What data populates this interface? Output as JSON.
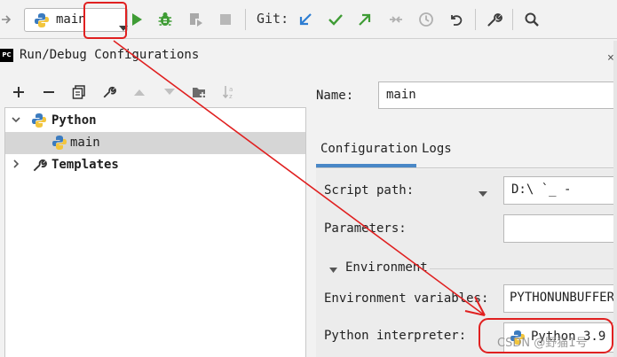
{
  "toolbar": {
    "run_config_label": "main",
    "git_label": "Git:",
    "icons": [
      "arrow-right-icon",
      "python-icon",
      "chevron-down-icon",
      "run-icon",
      "debug-icon",
      "coverage-icon",
      "stop-icon",
      "git-update-icon",
      "git-commit-icon",
      "git-push-icon",
      "git-compare-icon",
      "git-history-icon",
      "git-rollback-icon",
      "settings-icon",
      "search-icon"
    ]
  },
  "dialog": {
    "title": "Run/Debug Configurations",
    "logo_text": "PC"
  },
  "tree_tools": [
    "add-icon",
    "remove-icon",
    "copy-icon",
    "edit-wrench-icon",
    "move-up-icon",
    "move-down-icon",
    "new-folder-icon",
    "sort-icon"
  ],
  "tree": {
    "python_label": "Python",
    "main_label": "main",
    "templates_label": "Templates"
  },
  "form": {
    "name_label": "Name:",
    "name_value": "main",
    "tab_configuration": "Configuration",
    "tab_logs": "Logs",
    "script_path_label": "Script path:",
    "script_path_value": "D:\\   `_      -",
    "parameters_label": "Parameters:",
    "parameters_value": "",
    "environment_label": "Environment",
    "env_vars_label": "Environment variables:",
    "env_vars_value": "PYTHONUNBUFFERED",
    "interpreter_label": "Python interpreter:",
    "interpreter_value": "Python 3.9"
  },
  "watermark": "CSDN @野猫1号",
  "colors": {
    "accent_blue": "#4a88c7",
    "run_green": "#3f9c35",
    "annotation_red": "#e02020",
    "selection_gray": "#d6d6d6"
  }
}
